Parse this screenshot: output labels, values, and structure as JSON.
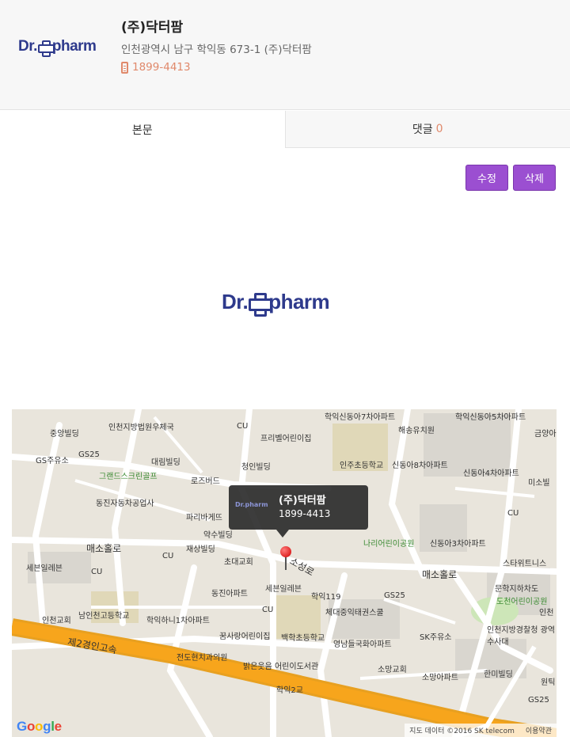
{
  "header": {
    "logo_text_left": "Dr.",
    "logo_text_right": "pharm",
    "name": "(주)닥터팜",
    "address": "인천광역시 남구 학익동 673-1 (주)닥터팜",
    "phone": "1899-4413"
  },
  "tabs": [
    {
      "label": "본문",
      "count": ""
    },
    {
      "label": "댓글",
      "count": "0"
    }
  ],
  "actions": {
    "edit": "수정",
    "delete": "삭제"
  },
  "content": {
    "logo_left": "Dr.",
    "logo_right": "pharm"
  },
  "map": {
    "infowindow": {
      "logo": "Dr.pharm",
      "title": "(주)닥터팜",
      "phone": "1899-4413"
    },
    "labels": [
      "학익신동아7차아파트",
      "학익신동아5차아파트",
      "중앙빌딩",
      "인천지방법원우체국",
      "CU",
      "해송유치원",
      "금양아",
      "프리벨어린이집",
      "GS주유소",
      "GS25",
      "대림빌딩",
      "인주초등학교",
      "신동아8차아파트",
      "그랜드스크린골프",
      "로즈버드",
      "청인빌딩",
      "신동아4차아파트",
      "동진자동차공업사",
      "파리바게뜨",
      "미소빌",
      "CU",
      "약수빌딩",
      "나리어린이공원",
      "신동아3차아파트",
      "매소홀로",
      "재상빌딩",
      "CU",
      "스타위트니스",
      "세븐일레븐",
      "CU",
      "초대교회",
      "매소홀로",
      "동진아파트",
      "세븐일레븐",
      "학익119",
      "GS25",
      "문학지하차도",
      "도천어린이공원",
      "인천교회",
      "남인천고등학교",
      "CU",
      "체대중익태권스쿨",
      "학익하니1차아파트",
      "꿈사랑어린이집",
      "백학초등학교",
      "SK주유소",
      "인천지방경찰청 광역수사대",
      "제2경인고속",
      "전도현치과의원",
      "영남들국화아파트",
      "소망교회",
      "밝은웃음 어린이도서관",
      "소망아파트",
      "한미빌딩",
      "학익2교",
      "GS25",
      "인천",
      "소성로",
      "원틱"
    ],
    "attribution": "지도 데이터 ©2016 SK telecom",
    "terms": "이용약관"
  }
}
